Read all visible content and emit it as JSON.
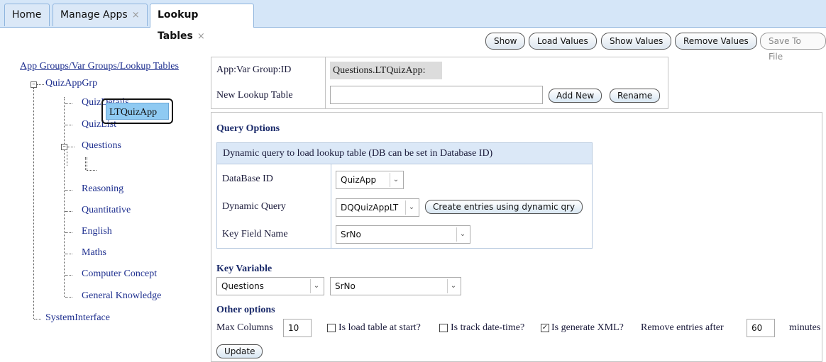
{
  "tabs": [
    {
      "label": "Home",
      "closable": false
    },
    {
      "label": "Manage Apps",
      "closable": true
    },
    {
      "label": "Lookup Tables",
      "closable": true,
      "active": true
    }
  ],
  "close_glyph": "×",
  "toolbar": {
    "show": "Show",
    "load_values": "Load Values",
    "show_values": "Show Values",
    "remove_values": "Remove Values",
    "save_to_file": "Save To File"
  },
  "tree": {
    "root": "App Groups/Var Groups/Lookup Tables",
    "group": "QuizAppGrp",
    "items": [
      "QuizDetails",
      "QuizList",
      "Questions",
      "Reasoning",
      "Quantitative",
      "English",
      "Maths",
      "Computer Concept",
      "General Knowledge"
    ],
    "selected_child": "LTQuizApp",
    "system": "SystemInterface"
  },
  "app_info": {
    "app_var_group_label": "App:Var Group:ID",
    "app_var_group_value": "Questions.LTQuizApp:",
    "new_lookup_label": "New Lookup Table",
    "new_lookup_value": "",
    "add_new": "Add New",
    "rename": "Rename"
  },
  "query_options": {
    "title": "Query Options",
    "dynamic_header": "Dynamic query to load lookup table (DB can be set in Database ID)",
    "database_id_label": "DataBase ID",
    "database_id_value": "QuizApp",
    "dynamic_query_label": "Dynamic Query",
    "dynamic_query_value": "DQQuizAppLT",
    "create_entries": "Create entries using dynamic qry",
    "key_field_label": "Key Field Name",
    "key_field_value": "SrNo"
  },
  "key_variable": {
    "title": "Key Variable",
    "var_value": "Questions",
    "field_value": "SrNo"
  },
  "other_options": {
    "title": "Other options",
    "max_columns_label": "Max Columns",
    "max_columns_value": "10",
    "load_at_start_label": "Is load table at start?",
    "load_at_start_checked": false,
    "track_datetime_label": "Is track date-time?",
    "track_datetime_checked": false,
    "generate_xml_label": "Is generate XML?",
    "generate_xml_checked": true,
    "remove_entries_label": "Remove entries after",
    "remove_entries_value": "60",
    "minutes_label": "minutes",
    "update": "Update"
  }
}
